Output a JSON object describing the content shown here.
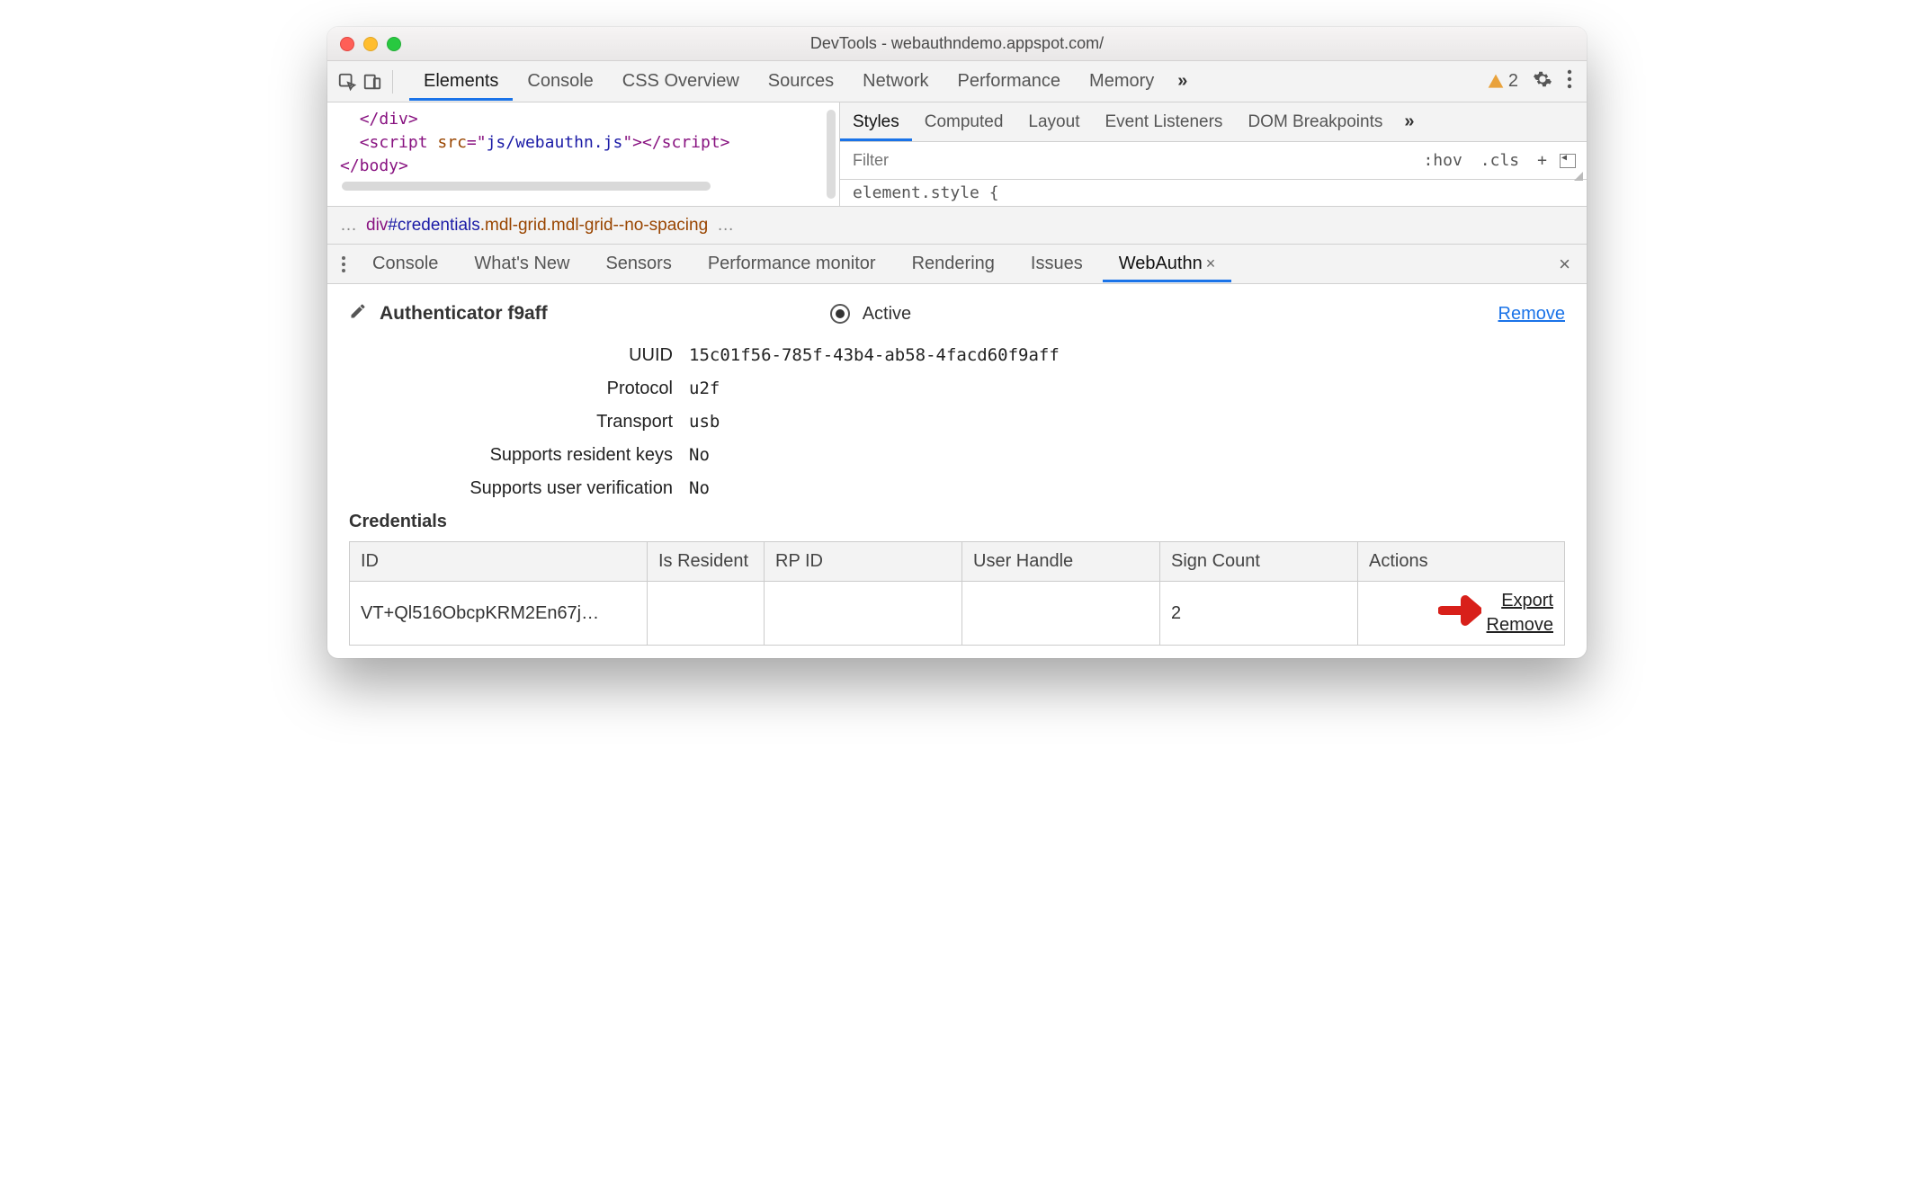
{
  "window": {
    "title": "DevTools - webauthndemo.appspot.com/"
  },
  "toolbar": {
    "tabs": [
      "Elements",
      "Console",
      "CSS Overview",
      "Sources",
      "Network",
      "Performance",
      "Memory"
    ],
    "active_tab": "Elements",
    "more_glyph": "»",
    "warning_count": "2"
  },
  "code": {
    "line1_close": "</div>",
    "line2_open": "<script ",
    "line2_attr": "src",
    "line2_eq": "=\"",
    "line2_val": "js/webauthn.js",
    "line2_close": "\"></scr",
    "line2_end": "ipt>",
    "line3": "</body>"
  },
  "styles": {
    "tabs": [
      "Styles",
      "Computed",
      "Layout",
      "Event Listeners",
      "DOM Breakpoints"
    ],
    "active_tab": "Styles",
    "more_glyph": "»",
    "filter_placeholder": "Filter",
    "hov": ":hov",
    "cls": ".cls",
    "element_style": "element.style {"
  },
  "breadcrumb": {
    "dots_left": "…",
    "tag": "div",
    "id": "#credentials",
    "cls": ".mdl-grid.mdl-grid--no-spacing",
    "dots_right": "…"
  },
  "drawer": {
    "tabs": [
      "Console",
      "What's New",
      "Sensors",
      "Performance monitor",
      "Rendering",
      "Issues",
      "WebAuthn"
    ],
    "active_tab": "WebAuthn"
  },
  "authenticator": {
    "title": "Authenticator f9aff",
    "active_label": "Active",
    "remove_label": "Remove",
    "props": [
      {
        "label": "UUID",
        "value": "15c01f56-785f-43b4-ab58-4facd60f9aff"
      },
      {
        "label": "Protocol",
        "value": "u2f"
      },
      {
        "label": "Transport",
        "value": "usb"
      },
      {
        "label": "Supports resident keys",
        "value": "No"
      },
      {
        "label": "Supports user verification",
        "value": "No"
      }
    ]
  },
  "credentials": {
    "heading": "Credentials",
    "columns": [
      "ID",
      "Is Resident",
      "RP ID",
      "User Handle",
      "Sign Count",
      "Actions"
    ],
    "rows": [
      {
        "id": "VT+Ql516ObcpKRM2En67j…",
        "is_resident": "",
        "rp_id": "",
        "user_handle": "",
        "sign_count": "2"
      }
    ],
    "export_label": "Export",
    "remove_label": "Remove"
  }
}
